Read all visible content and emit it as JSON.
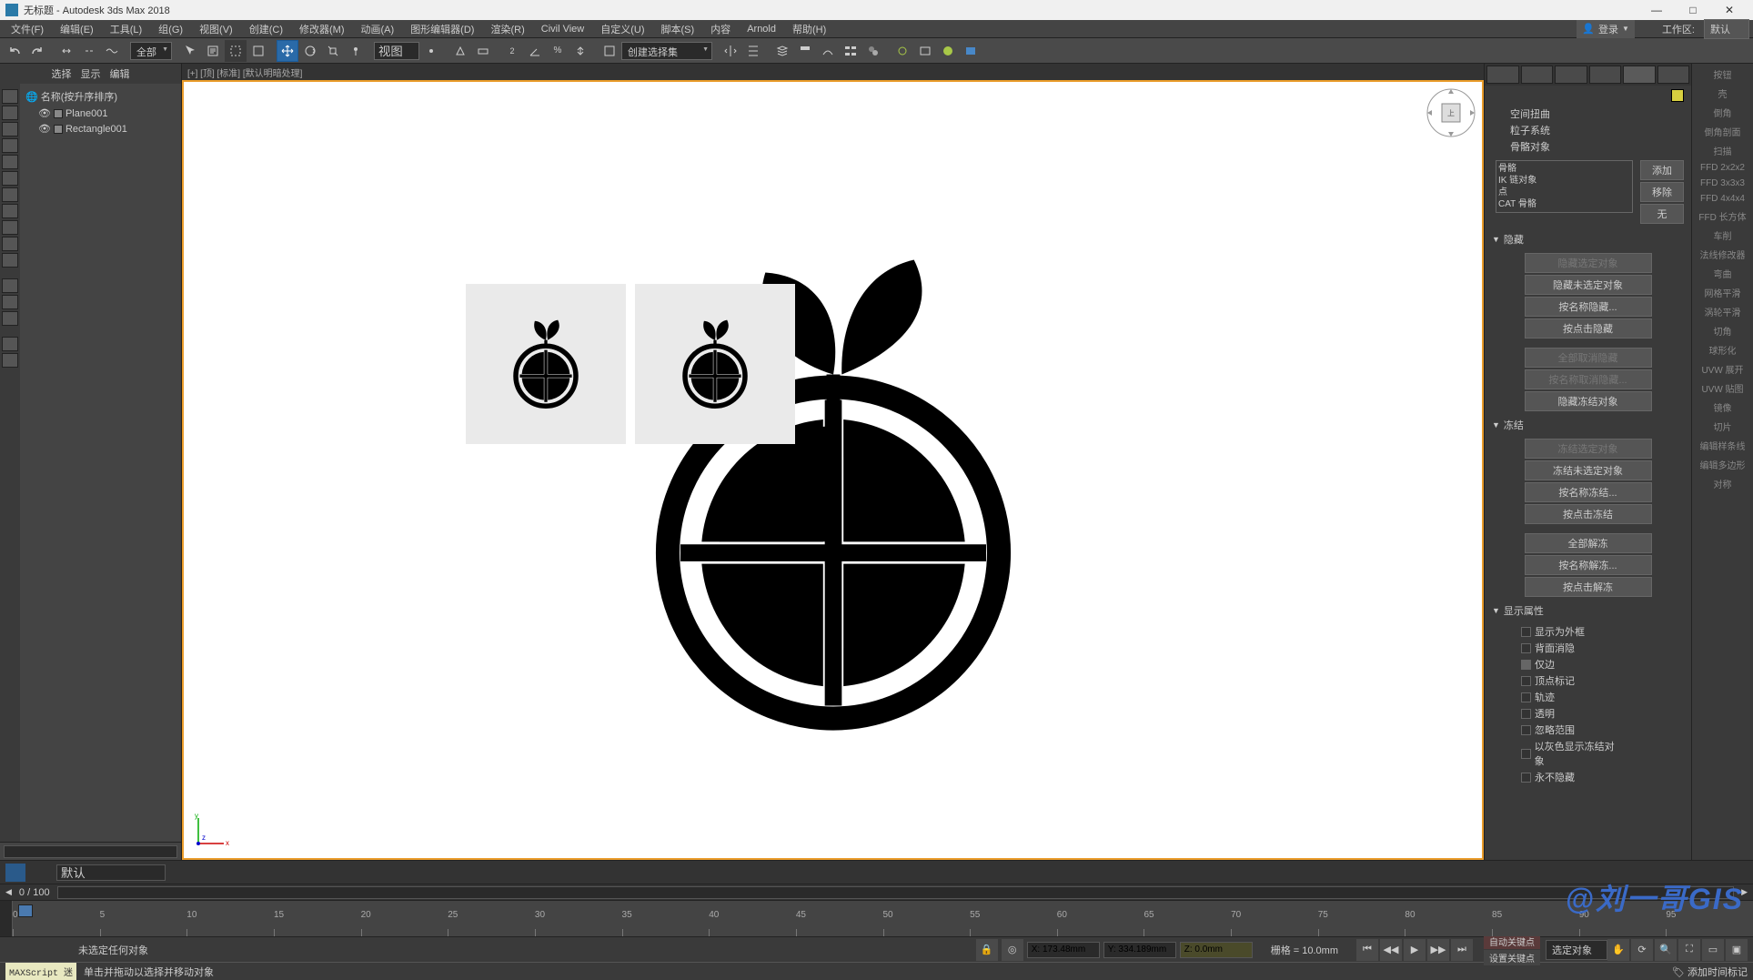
{
  "title": "无标题 - Autodesk 3ds Max 2018",
  "menu": {
    "file": "文件(F)",
    "edit": "编辑(E)",
    "tools": "工具(L)",
    "group": "组(G)",
    "view": "视图(V)",
    "create": "创建(C)",
    "modifiers": "修改器(M)",
    "animation": "动画(A)",
    "grapheditors": "图形编辑器(D)",
    "rendering": "渲染(R)",
    "civilview": "Civil View",
    "customize": "自定义(U)",
    "scripting": "脚本(S)",
    "content": "内容",
    "arnold": "Arnold",
    "help": "帮助(H)"
  },
  "login": "登录",
  "workspace_label": "工作区:",
  "workspace_value": "默认",
  "toolbar": {
    "all": "全部",
    "viewlabel": "视图",
    "selset": "创建选择集"
  },
  "lefttabs": {
    "sel": "选择",
    "disp": "显示",
    "edit": "编辑"
  },
  "scene": {
    "header": "名称(按升序排序)",
    "item1": "Plane001",
    "item2": "Rectangle001"
  },
  "viewport_label": "[+] [顶] [标准] [默认明暗处理]",
  "right": {
    "opts": {
      "spacewarp": "空间扭曲",
      "particles": "粒子系统",
      "bones": "骨骼对象"
    },
    "boxitems": {
      "bone": "骨骼",
      "ik": "IK 链对象",
      "point": "点",
      "cat": "CAT 骨骼"
    },
    "btn_add": "添加",
    "btn_remove": "移除",
    "btn_none": "无",
    "sec_hide": "隐藏",
    "hide_sel": "隐藏选定对象",
    "hide_unsel": "隐藏未选定对象",
    "hide_byname": "按名称隐藏...",
    "hide_byhit": "按点击隐藏",
    "unhide_all": "全部取消隐藏",
    "unhide_byname": "按名称取消隐藏...",
    "hide_frozen": "隐藏冻结对象",
    "sec_freeze": "冻结",
    "freeze_sel": "冻结选定对象",
    "freeze_unsel": "冻结未选定对象",
    "freeze_byname": "按名称冻结...",
    "freeze_byhit": "按点击冻结",
    "unfreeze_all": "全部解冻",
    "unfreeze_byname": "按名称解冻...",
    "unfreeze_byhit": "按点击解冻",
    "sec_dispprops": "显示属性",
    "dp_seethrough": "显示为外框",
    "dp_backface": "背面消隐",
    "dp_edgesonly": "仅边",
    "dp_vertticks": "顶点标记",
    "dp_trajectory": "轨迹",
    "dp_transparent": "透明",
    "dp_ignoreextent": "忽略范围",
    "dp_showfrozengray": "以灰色显示冻结对象",
    "dp_novisible": "永不隐藏"
  },
  "modlist": {
    "button": "按钮",
    "shell": "壳",
    "chamfer": "倒角",
    "chamferprof": "倒角剖面",
    "sweep": "扫描",
    "ffd2": "FFD 2x2x2",
    "ffd3": "FFD 3x3x3",
    "ffd4": "FFD 4x4x4",
    "ffdbox": "FFD 长方体",
    "lathe": "车削",
    "normal": "法线修改器",
    "bend": "弯曲",
    "meshsmooth": "网格平滑",
    "turbosmooth": "涡轮平滑",
    "slice": "切角",
    "spherify": "球形化",
    "uvwunwrap": "UVW 展开",
    "uvwmap": "UVW 贴图",
    "mirror": "镜像",
    "slice2": "切片",
    "editspline": "编辑样条线",
    "editpoly": "编辑多边形",
    "symmetry": "对称"
  },
  "layerbar": {
    "default": "默认"
  },
  "frames": {
    "range": "0 / 100"
  },
  "status": {
    "nosel": "未选定任何对象",
    "x": "X: 173.48mm",
    "y": "Y: 334.189mm",
    "z": "Z: 0.0mm",
    "grid": "栅格 = 10.0mm",
    "addtimetag": "添加时间标记",
    "autokey": "自动关键点",
    "selobj": "选定对象",
    "setkey": "设置关键点",
    "hint": "单击并拖动以选择并移动对象",
    "maxscript": "MAXScript 迷"
  },
  "watermark": "@刘一哥GIS"
}
